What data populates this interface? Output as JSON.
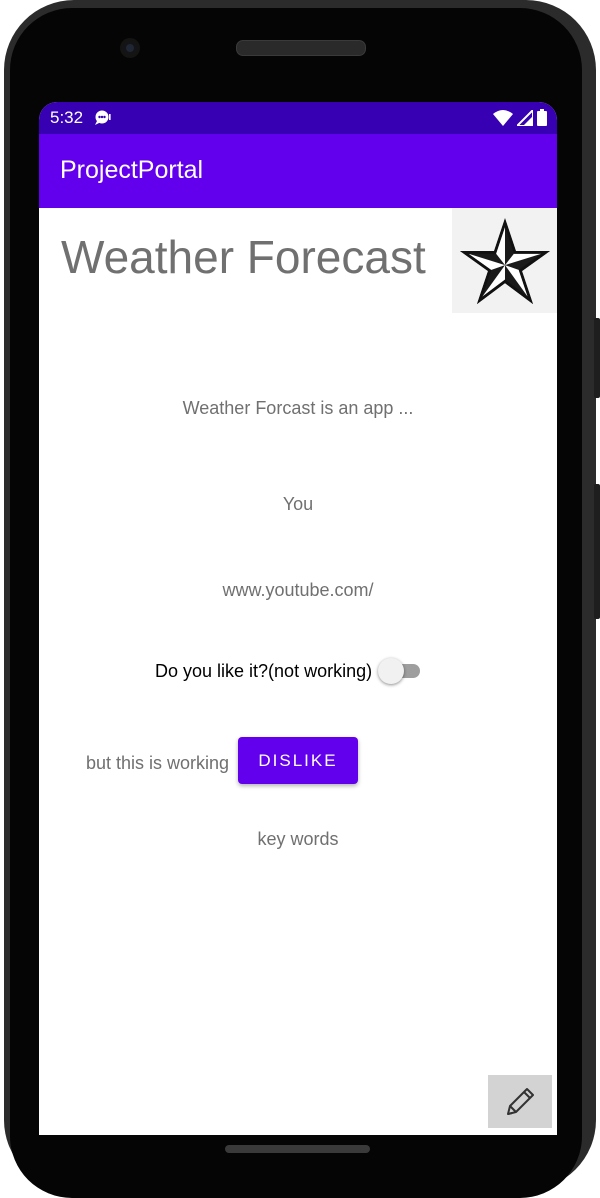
{
  "status_bar": {
    "time": "5:32",
    "icons": [
      "chat-bubble-icon",
      "wifi-icon",
      "cell-signal-icon",
      "battery-icon"
    ]
  },
  "app_bar": {
    "title": "ProjectPortal"
  },
  "main": {
    "title": "Weather Forecast",
    "description": "Weather Forcast is an app ...",
    "author": "You",
    "link": "www.youtube.com/",
    "switch": {
      "label": "Do you like it?(not working)",
      "checked": false
    },
    "working_label": "but this is working",
    "dislike_button": "DISLIKE",
    "keywords": "key words",
    "image_icon": "star-icon",
    "edit_icon": "pencil-icon"
  },
  "colors": {
    "status_bar": "#3700b3",
    "primary": "#6200ee",
    "secondary_text": "#707070"
  }
}
